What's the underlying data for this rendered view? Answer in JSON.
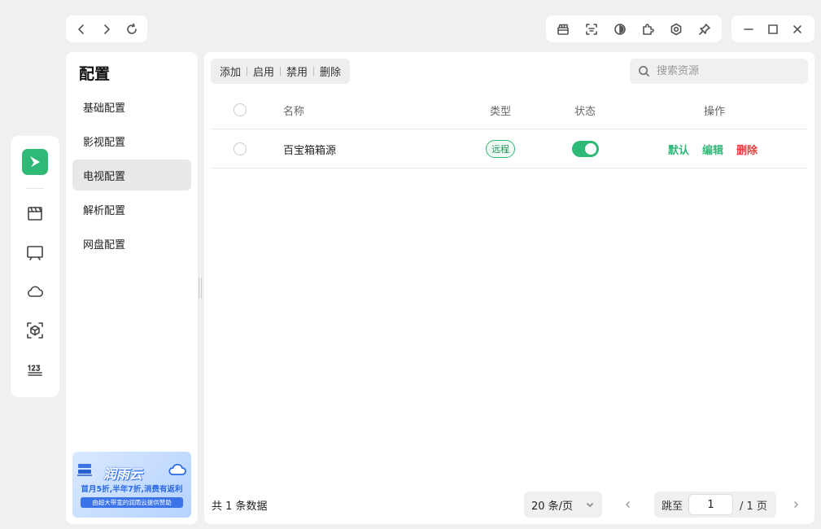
{
  "nav": {
    "back_icon": "chevron-left-icon",
    "forward_icon": "chevron-right-icon",
    "refresh_icon": "refresh-icon"
  },
  "toolbar": {
    "icons": [
      "gift-icon",
      "scan-icon",
      "theme-icon",
      "plugin-icon",
      "settings-icon",
      "pin-icon"
    ]
  },
  "window": {
    "icons": [
      "minimize-icon",
      "maximize-icon",
      "close-icon"
    ]
  },
  "rail": {
    "items": [
      "film-icon",
      "tv-icon",
      "cloud-icon",
      "cube-scan-icon",
      "number-icon"
    ]
  },
  "sidebar": {
    "title": "配置",
    "items": [
      {
        "label": "基础配置",
        "active": false
      },
      {
        "label": "影视配置",
        "active": false
      },
      {
        "label": "电视配置",
        "active": true
      },
      {
        "label": "解析配置",
        "active": false
      },
      {
        "label": "网盘配置",
        "active": false
      }
    ],
    "ad": {
      "title": "润雨云",
      "line1": "首月5折,半年7折,消费有返利",
      "line2": "由超大带宽的润雨云提供赞助"
    }
  },
  "main": {
    "actions": [
      "添加",
      "启用",
      "禁用",
      "删除"
    ],
    "search": {
      "placeholder": "搜索资源",
      "value": ""
    },
    "table": {
      "headers": {
        "name": "名称",
        "type": "类型",
        "status": "状态",
        "ops": "操作"
      },
      "rows": [
        {
          "name": "百宝箱箱源",
          "type": "远程",
          "enabled": true,
          "ops": [
            "默认",
            "编辑",
            "删除"
          ]
        }
      ]
    },
    "pagination": {
      "total": "共 1 条数据",
      "page_size": "20 条/页",
      "jump_label": "跳至",
      "current_page": "1",
      "page_count": "/ 1 页"
    }
  },
  "colors": {
    "accent": "#2fb977",
    "danger": "#e0403a"
  }
}
